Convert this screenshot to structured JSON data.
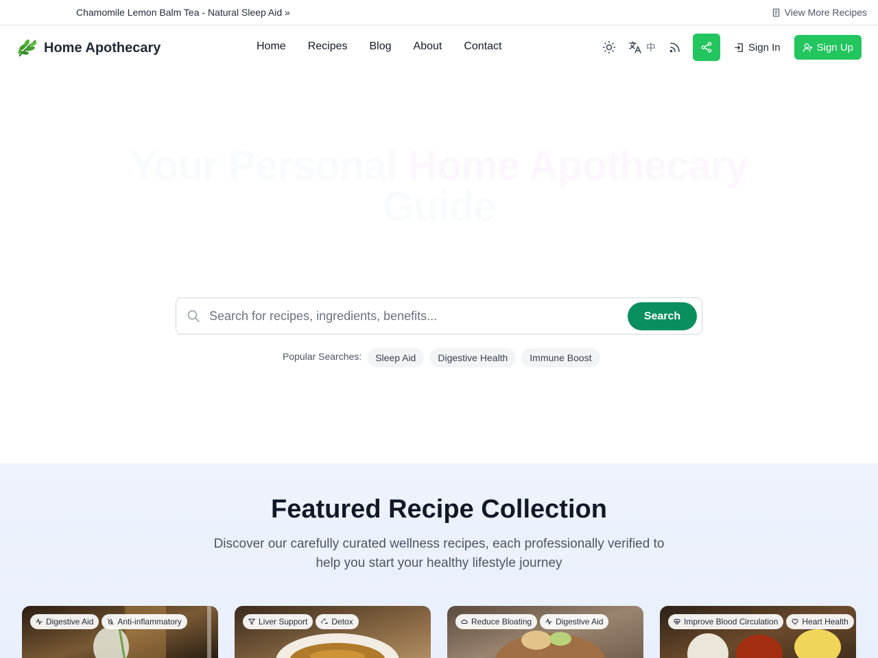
{
  "announcement": {
    "text": "Chamomile Lemon Balm Tea - Natural Sleep Aid »",
    "more_label": "View More Recipes"
  },
  "brand": {
    "name": "Home Apothecary",
    "logo_icon": "herb-leaves-icon"
  },
  "nav": {
    "items": [
      {
        "label": "Home"
      },
      {
        "label": "Recipes"
      },
      {
        "label": "Blog"
      },
      {
        "label": "About"
      },
      {
        "label": "Contact"
      }
    ],
    "language_label": "中",
    "sign_in": "Sign In",
    "sign_up": "Sign Up"
  },
  "hero": {
    "title_start": "Your Personal ",
    "title_accent": "Home Apothecary",
    "title_end": " Guide",
    "search_placeholder": "Search for recipes, ingredients, benefits...",
    "search_button": "Search",
    "popular_label": "Popular Searches:",
    "popular": [
      "Sleep Aid",
      "Digestive Health",
      "Immune Boost"
    ]
  },
  "featured": {
    "title": "Featured Recipe Collection",
    "subtitle": "Discover our carefully curated wellness recipes, each professionally verified to help you start your healthy lifestyle journey",
    "cards": [
      {
        "tags": [
          {
            "icon": "pulse-icon",
            "label": "Digestive Aid"
          },
          {
            "icon": "flame-off-icon",
            "label": "Anti-inflammatory"
          }
        ]
      },
      {
        "tags": [
          {
            "icon": "filter-icon",
            "label": "Liver Support"
          },
          {
            "icon": "recycle-icon",
            "label": "Detox"
          }
        ]
      },
      {
        "tags": [
          {
            "icon": "cloud-icon",
            "label": "Reduce Bloating"
          },
          {
            "icon": "pulse-icon",
            "label": "Digestive Aid"
          }
        ]
      },
      {
        "tags": [
          {
            "icon": "heart-pulse-icon",
            "label": "Improve Blood Circulation"
          },
          {
            "icon": "heart-icon",
            "label": "Heart Health"
          }
        ]
      }
    ]
  },
  "colors": {
    "primary_green": "#22c55e",
    "search_green": "#0a8f5f",
    "featured_bg": "#eef3fd"
  }
}
